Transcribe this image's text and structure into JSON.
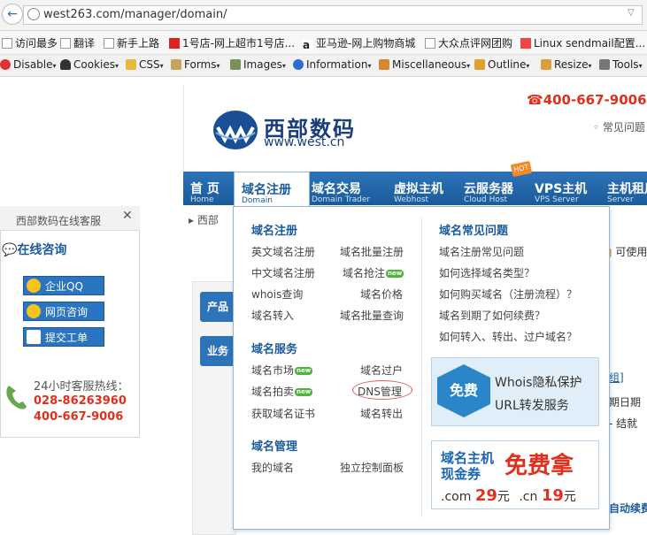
{
  "browser": {
    "url": "west263.com/manager/domain/",
    "bookmarks": [
      "访问最多",
      "翻译",
      "新手上路",
      "1号店-网上超市1号店...",
      "亚马逊-网上购物商城",
      "大众点评网团购",
      "Linux sendmail配置..."
    ],
    "devtools": [
      "Disable",
      "Cookies",
      "CSS",
      "Forms",
      "Images",
      "Information",
      "Miscellaneous",
      "Outline",
      "Resize",
      "Tools"
    ]
  },
  "site": {
    "logo_cn": "西部数码",
    "logo_en": "www.west.cn",
    "phone": "400-667-9006",
    "faq_top": "常见问题",
    "breadcrumb": "西部",
    "hot_badge": "HOT"
  },
  "nav": [
    {
      "cn": "首 页",
      "en": "Home"
    },
    {
      "cn": "域名注册",
      "en": "Domain"
    },
    {
      "cn": "域名交易",
      "en": "Domain Trader"
    },
    {
      "cn": "虚拟主机",
      "en": "Webhost"
    },
    {
      "cn": "云服务器",
      "en": "Cloud Host"
    },
    {
      "cn": "VPS主机",
      "en": "VPS Server"
    },
    {
      "cn": "主机租用",
      "en": "Server"
    }
  ],
  "dropdown": {
    "domain_register": {
      "title": "域名注册",
      "items": [
        "英文域名注册",
        "域名批量注册",
        "中文域名注册",
        "域名抢注",
        "whois查询",
        "域名价格",
        "域名转入",
        "域名批量查询"
      ]
    },
    "domain_service": {
      "title": "域名服务",
      "items": [
        "域名市场",
        "域名过户",
        "域名拍卖",
        "DNS管理",
        "获取域名证书",
        "域名转出"
      ]
    },
    "domain_manage": {
      "title": "域名管理",
      "items": [
        "我的域名",
        "独立控制面板"
      ]
    },
    "faq": {
      "title": "域名常见问题",
      "items": [
        "域名注册常见问题",
        "如何选择域名类型？",
        "如何购买域名（注册流程）？",
        "域名到期了如何续费？",
        "如何转入、转出、过户域名？"
      ]
    },
    "new_label": "new",
    "promo1": {
      "badge": "免费",
      "line1": "Whois隐私保护",
      "line2": "URL转发服务"
    },
    "promo2": {
      "line_a": "域名主机",
      "line_b": "现金券",
      "big": "免费拿",
      "com": ".com",
      "com_price": "29",
      "cn": ".cn",
      "cn_price": "19",
      "unit": "元"
    }
  },
  "page_behind": {
    "side1": "产品",
    "side2": "业务",
    "peek_available": "可使用",
    "peek_group": "组]",
    "peek_expire": "期日期",
    "peek_end": "- 结就",
    "peek_renew": "自动续费"
  },
  "customer_service": {
    "title": "西部数码在线客服",
    "online": "在线咨询",
    "buttons": [
      "企业QQ",
      "网页咨询",
      "提交工单"
    ],
    "hotline_label": "24小时客服热线：",
    "hotline1": "028-86263960",
    "hotline2": "400-667-9006"
  },
  "colors": {
    "nav_blue": "#1a5b9b",
    "accent_red": "#e0301e"
  }
}
